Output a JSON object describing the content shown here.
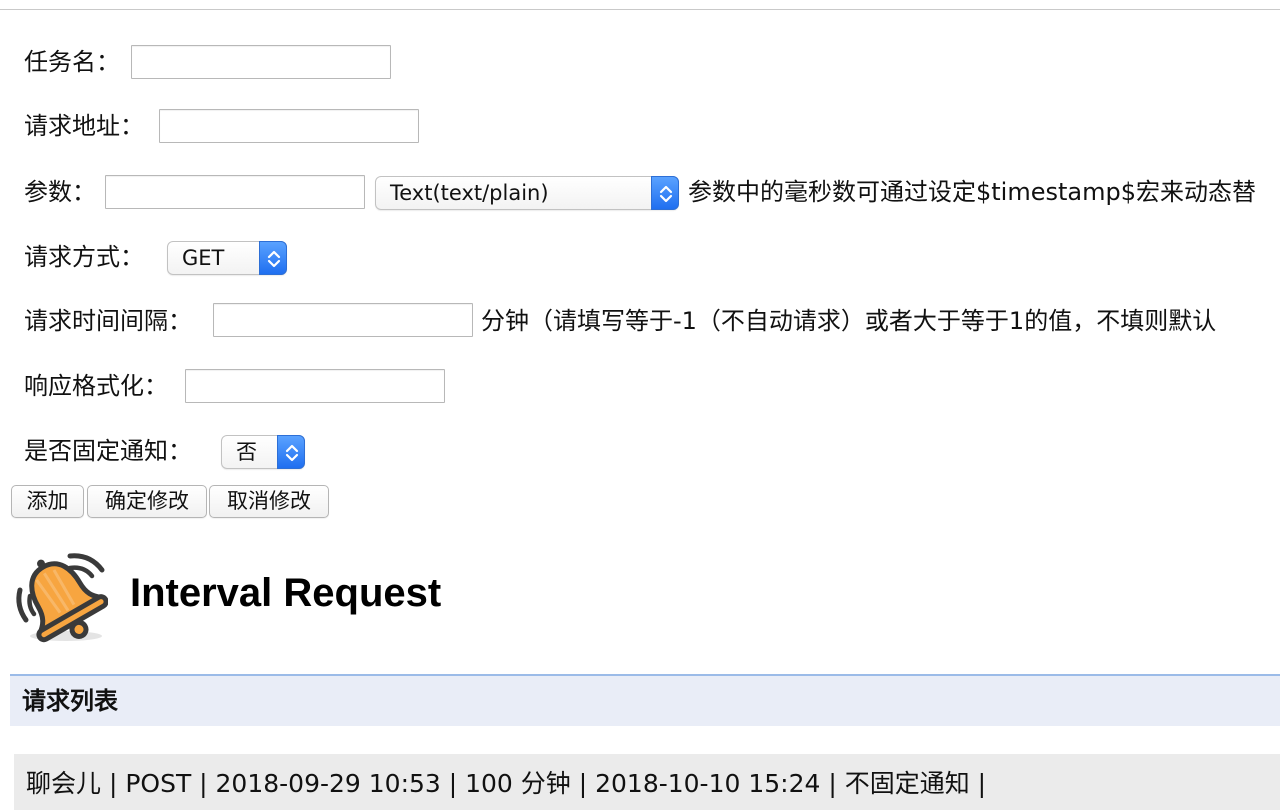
{
  "form": {
    "task_name_label": "任务名：",
    "task_name_value": "",
    "url_label": "请求地址：",
    "url_value": "",
    "params_label": "参数：",
    "params_value": "",
    "content_type_selected": "Text(text/plain)",
    "params_note": "参数中的毫秒数可通过设定$timestamp$宏来动态替",
    "method_label": "请求方式：",
    "method_selected": "GET",
    "interval_label": "请求时间间隔：",
    "interval_value": "",
    "interval_note": "分钟（请填写等于-1（不自动请求）或者大于等于1的值，不填则默认",
    "format_label": "响应格式化：",
    "format_value": "",
    "pin_label": "是否固定通知：",
    "pin_selected": "否"
  },
  "buttons": {
    "add": "添加",
    "confirm_edit": "确定修改",
    "cancel_edit": "取消修改"
  },
  "app": {
    "title": "Interval Request",
    "logo_icon": "bell-ringing-icon"
  },
  "list": {
    "header": "请求列表",
    "items": [
      {
        "text": "聊会儿 | POST | 2018-09-29 10:53 | 100 分钟 | 2018-10-10 15:24 | 不固定通知 |"
      }
    ]
  },
  "colors": {
    "select_arrow": "#1f6ff0",
    "section_bar_bg": "#e9edf7",
    "section_bar_border": "#9bbbe8",
    "list_item_bg": "#ebebeb",
    "bell_fill": "#f7a540"
  }
}
